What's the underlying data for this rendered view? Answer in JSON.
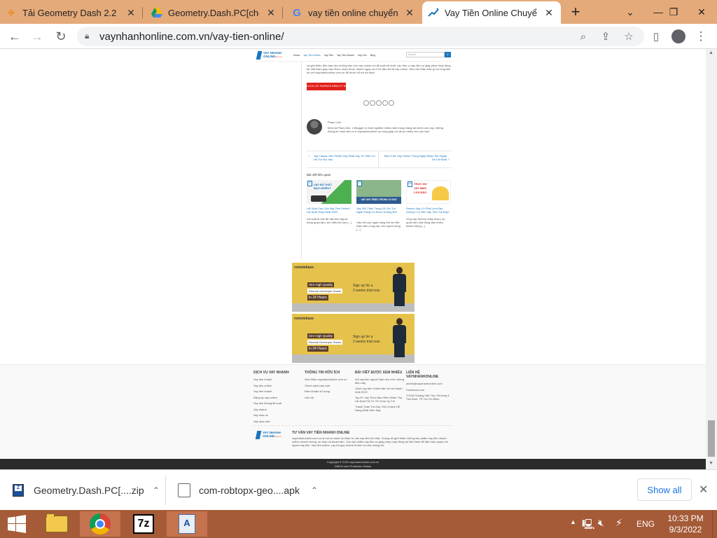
{
  "browser": {
    "tabs": [
      {
        "title": "Tải Geometry Dash 2.2 C",
        "active": false
      },
      {
        "title": "Geometry.Dash.PC[choig",
        "active": false
      },
      {
        "title": "vay tiền online chuyển kh",
        "active": false
      },
      {
        "title": "Vay Tiền Online Chuyển K",
        "active": true
      }
    ],
    "new_tab": "+",
    "url": "vaynhanhonline.com.vn/vay-tien-online/"
  },
  "site": {
    "logo_line1": "VAY NHANH",
    "logo_line2": "ONLINE",
    "logo_domain": ".com.vn",
    "nav": [
      "Home",
      "Vay Tiền Online",
      "Vay Tiền",
      "Vay Tiền Nhanh",
      "Vay Vốn",
      "Blog"
    ],
    "search_placeholder": "Search",
    "intro_text": "và giới thiệu đến bạn đọc những bản cho vay online với lãi suất tốt nhất. các đơn vị này đều có giấy phép hoạt động tại Việt Nam giúp bạn được nhận được nhanh ngay cả ở lúc đầu khi đi vay online. Nếu còn thắc mắc gì vui lòng liên hệ với vaynhanhonline.com.vn để được hỗ trợ tốt nhất.",
    "cta_button": "CLICK LẤY FANPAGE ĐĂNG KÝ NGAY",
    "share_icons": [
      "facebook",
      "twitter",
      "pinterest",
      "linkedin",
      "email"
    ],
    "author": {
      "name": "Phạm Linh",
      "bio": "Mình là Phạm linh, 1 Blogger có kinh nghiệm nhiều năm trong mảng tài chính cho vay, những thông tin mình tiền ra ở vaynhanhonline hy vọng giúp ích được nhiều cho các bạn."
    },
    "post_nav": {
      "prev": "Vay Cassa, Mid Online Hay Nhất Vay 10 Triệu Có Hỗ Trợ Nợ Xấu",
      "next": "Điều Kiện Vay Online Trong Ngày Nhận Tiền Ngay Và Tốt Nhất"
    },
    "related_heading": "Bài viết liên quan",
    "related": [
      {
        "img_caption": "VAY ĐÃ THẤT BẠO NHIÊU?",
        "badge": "12",
        "title": "Lãi Suất Cao Của Vay Tiền Online? Lãi Suất Thấp Nhất 2022",
        "excerpt": "Lãi suất là vấn đề đầu tiên người dùng quan tâm, tìm hiểu khi cần [...]"
      },
      {
        "img_caption": "VAY 300 TRIỆU TRONG 24 GIỜ",
        "badge": "12",
        "title": "Vay 300 Triệu Trong 24 Giờ Tại Ngân Hàng Có Được Không Nhỉ",
        "excerpt": "Hầu hết các ngân hàng lớn tại Việt Nam đều cung cấp cho người dùng [...]"
      },
      {
        "img_caption": "THỰC HƯ VAY MMO LỪA ĐẢO",
        "badge": "03",
        "title": "Senmo Vay Có Phải Lừa Đảo Không? Có Nên Vay Tiền Tại Đây?",
        "excerpt": "Ứng vay Senmo nhận được sự quan tâm của đông đảo nhiều khách hàng [...]"
      }
    ]
  },
  "ads": [
    {
      "brand": "remotebase",
      "headline_1": "Hire High Quality",
      "headline_2": "Remote Developer Teams",
      "headline_3": "in 24 Hours",
      "right_1": "Sign up for a",
      "right_2": "2 weeks trial now"
    },
    {
      "brand": "remotebase",
      "headline_1": "Hire High Quality",
      "headline_2": "Remote Developer Teams",
      "headline_3": "in 24 Hours",
      "right_1": "Sign up for a",
      "right_2": "2 weeks trial now"
    }
  ],
  "footer": {
    "col1": {
      "heading": "DỊCH VỤ VAY NHANH",
      "items": [
        "Vay tiền nhanh",
        "Vay tiền online",
        "Vay tiền nhanh",
        "Đăng ký vay online",
        "Vay tiền không lãi suất",
        "Vay nhanh",
        "Vay mua xe",
        "Vay mua nhà"
      ]
    },
    "col2": {
      "heading": "THÔNG TIN HỮU ÍCH",
      "items": [
        "Giới thiệu vaynhanhonline.com.vn",
        "Chính sách bảo mật",
        "Điều khoản sử dụng",
        "Liên hệ"
      ]
    },
    "col3": {
      "heading": "BÀI VIẾT ĐƯỢC XEM NHIỀU",
      "items": [
        "Khi vay tiền người thân nên nhớ những điều này",
        "Cách vay tiền Online tiện lợi và nhanh nhất 2022",
        "Top 8+ Vay Theo Bảo Hiểm Nhân Thọ Lãi Suất Tốt Từ Tổ Chức Uy Tín",
        "Thanh Toán Trả Góp Tiền Online Dễ Dàng Nhất Hiện Nay"
      ]
    },
    "col4": {
      "heading": "LIÊN HỆ VAYNHANHONLINE",
      "items": [
        "admin@vaynhanhonline.com",
        "Facebook.com",
        "174/20 Hoàng Văn Thụ, Phường 4, Tân Bình, TP. Hồ Chí Minh"
      ]
    },
    "about_heading": "TƯ VẤN VAY TIỀN NHANH ONLINE",
    "about_text": "vaynhanhonline.com.vn là nơi so sánh và nhận tư vấn vay tiền tốt nhất. Chúng tôi giới thiệu những sản phẩm vay tiền nhanh online nhanh chóng, an toàn và thuận tiện. Các sản phẩm vay đều có giấy phép hoạt động tại Việt Nam để đảm bảo quyền lợi người vay tiền. Vay tiền online, vay trả góp nhanh là dịch vụ của chúng tôi.",
    "copyright": "Copyright © 2022 vaynhanhonline.com.vn",
    "dmca": "DMCA.com Protection Status"
  },
  "downloads": [
    {
      "name": "Geometry.Dash.PC[....zip"
    },
    {
      "name": "com-robtopx-geo....apk"
    }
  ],
  "show_all": "Show all",
  "taskbar": {
    "lang": "ENG",
    "time": "10:33 PM",
    "date": "9/3/2022"
  },
  "colors": {
    "titlebar": "#e5aa7a",
    "taskbar": "#a55a38",
    "cta_red": "#e0201b",
    "ad_yellow": "#e5c24b",
    "footer_dark": "#2b2b2b"
  }
}
